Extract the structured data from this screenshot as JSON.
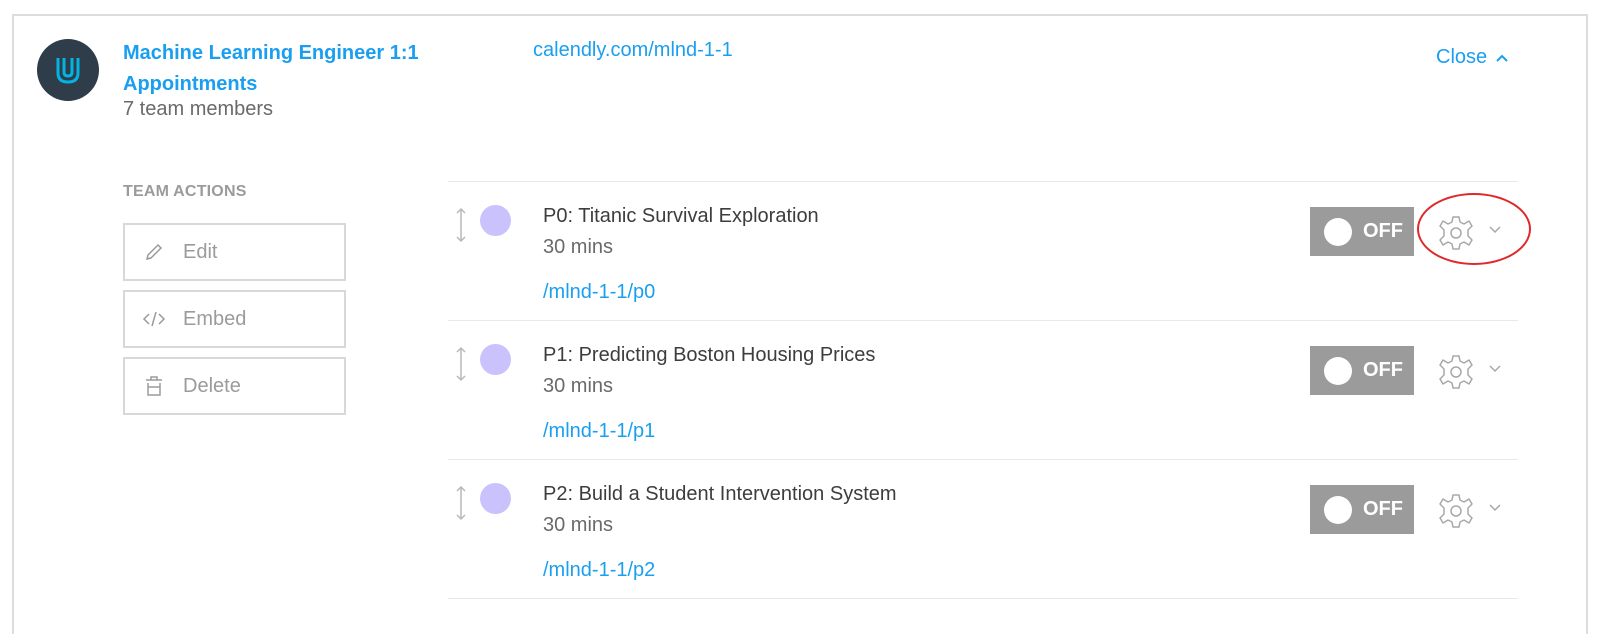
{
  "team": {
    "title": "Machine Learning Engineer 1:1 Appointments",
    "members": "7 team members",
    "url": "calendly.com/mlnd-1-1",
    "close_label": "Close"
  },
  "actions": {
    "heading": "TEAM ACTIONS",
    "items": [
      {
        "label": "Edit",
        "icon": "pencil-icon"
      },
      {
        "label": "Embed",
        "icon": "code-icon"
      },
      {
        "label": "Delete",
        "icon": "trash-icon"
      }
    ]
  },
  "events": [
    {
      "name": "P0: Titanic Survival Exploration",
      "duration": "30 mins",
      "link": "/mlnd-1-1/p0",
      "status": "OFF"
    },
    {
      "name": "P1: Predicting Boston Housing Prices",
      "duration": "30 mins",
      "link": "/mlnd-1-1/p1",
      "status": "OFF"
    },
    {
      "name": "P2: Build a Student Intervention System",
      "duration": "30 mins",
      "link": "/mlnd-1-1/p2",
      "status": "OFF"
    }
  ],
  "colors": {
    "accent": "#1a9ff0",
    "event_dot": "#c9c2fd",
    "toggle_off": "#9b9b9b",
    "highlight": "#e02828",
    "logo_bg": "#2e3d49"
  }
}
